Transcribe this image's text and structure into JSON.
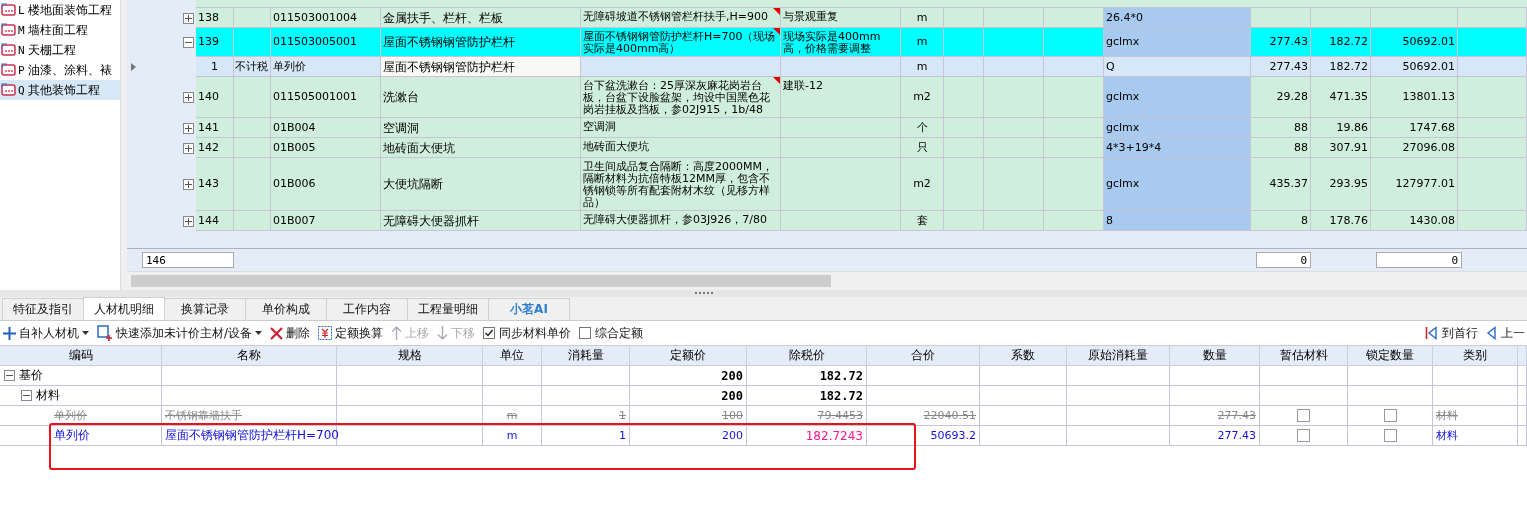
{
  "tree": {
    "items": [
      {
        "letter": "L",
        "label": "楼地面装饰工程",
        "selected": false
      },
      {
        "letter": "M",
        "label": "墙柱面工程",
        "selected": false
      },
      {
        "letter": "N",
        "label": "天棚工程",
        "selected": false
      },
      {
        "letter": "P",
        "label": "油漆、涂料、裱",
        "selected": false
      },
      {
        "letter": "Q",
        "label": "其他装饰工程",
        "selected": true
      }
    ]
  },
  "grid": {
    "rows": [
      {
        "kind": "item",
        "expanded": false,
        "selected": false,
        "flagged": true,
        "number": "138",
        "tax": "",
        "code": "011503001004",
        "name": "金属扶手、栏杆、栏板",
        "feature": "无障碍坡道不锈钢管栏杆扶手,H=900",
        "remark": "与景观重复",
        "unit": "m",
        "expression": "26.4*0",
        "quantity": "",
        "price": "",
        "total": ""
      },
      {
        "kind": "item",
        "expanded": true,
        "selected": true,
        "flagged": true,
        "number": "139",
        "tax": "",
        "code": "011503005001",
        "name": "屋面不锈钢钢管防护栏杆",
        "feature": "屋面不锈钢钢管防护栏杆H=700（现场实际是400mm高）",
        "remark": "现场实际是400mm高，价格需要调整",
        "unit": "m",
        "expression": "gclmx",
        "quantity": "277.43",
        "price": "182.72",
        "total": "50692.01"
      },
      {
        "kind": "sub",
        "expanded": false,
        "selected": false,
        "flagged": false,
        "number": "1",
        "tax": "不计税",
        "code": "单列价",
        "name": "屋面不锈钢钢管防护栏杆",
        "feature": "",
        "remark": "",
        "unit": "m",
        "expression": "Q",
        "quantity": "277.43",
        "price": "182.72",
        "total": "50692.01"
      },
      {
        "kind": "item",
        "expanded": false,
        "selected": false,
        "flagged": true,
        "number": "140",
        "tax": "",
        "code": "011505001001",
        "name": "洗漱台",
        "feature": "台下盆洗漱台：25厚深灰麻花岗岩台板，台盆下设脸盆架，均设中国黑色花岗岩挂板及挡板，参02J915，1b/48",
        "remark": "建联-12",
        "unit": "m2",
        "expression": "gclmx",
        "quantity": "29.28",
        "price": "471.35",
        "total": "13801.13"
      },
      {
        "kind": "item",
        "expanded": false,
        "selected": false,
        "flagged": false,
        "number": "141",
        "tax": "",
        "code": "01B004",
        "name": "空调洞",
        "feature": "空调洞",
        "remark": "",
        "unit": "个",
        "expression": "gclmx",
        "quantity": "88",
        "price": "19.86",
        "total": "1747.68"
      },
      {
        "kind": "item",
        "expanded": false,
        "selected": false,
        "flagged": false,
        "number": "142",
        "tax": "",
        "code": "01B005",
        "name": "地砖面大便坑",
        "feature": "地砖面大便坑",
        "remark": "",
        "unit": "只",
        "expression": "4*3+19*4",
        "quantity": "88",
        "price": "307.91",
        "total": "27096.08"
      },
      {
        "kind": "item",
        "expanded": false,
        "selected": false,
        "flagged": false,
        "number": "143",
        "tax": "",
        "code": "01B006",
        "name": "大便坑隔断",
        "feature": "卫生间成品复合隔断：高度2000MM，隔断材料为抗倍特板12MM厚，包含不锈钢锁等所有配套附材木纹（见移方样品）",
        "remark": "",
        "unit": "m2",
        "expression": "gclmx",
        "quantity": "435.37",
        "price": "293.95",
        "total": "127977.01"
      },
      {
        "kind": "item",
        "expanded": false,
        "selected": false,
        "flagged": false,
        "number": "144",
        "tax": "",
        "code": "01B007",
        "name": "无障碍大便器抓杆",
        "feature": "无障碍大便器抓杆，参03J926，7/80",
        "remark": "",
        "unit": "套",
        "expression": "8",
        "quantity": "8",
        "price": "178.76",
        "total": "1430.08"
      }
    ],
    "footer": {
      "count": "146",
      "quantity_sum": "0",
      "total_sum": "0"
    }
  },
  "tabs": [
    {
      "label": "特征及指引",
      "selected": false,
      "kind": "plain"
    },
    {
      "label": "人材机明细",
      "selected": true,
      "kind": "plain"
    },
    {
      "label": "换算记录",
      "selected": false,
      "kind": "plain"
    },
    {
      "label": "单价构成",
      "selected": false,
      "kind": "plain"
    },
    {
      "label": "工作内容",
      "selected": false,
      "kind": "plain"
    },
    {
      "label": "工程量明细",
      "selected": false,
      "kind": "plain"
    },
    {
      "label": "小茗AI",
      "selected": false,
      "kind": "ai"
    }
  ],
  "toolbar": {
    "items": [
      {
        "kind": "plus",
        "label": "自补人材机",
        "dropdown": true,
        "disabled": false
      },
      {
        "kind": "add",
        "label": "快速添加未计价主材/设备",
        "dropdown": true,
        "disabled": false
      },
      {
        "kind": "delete",
        "label": "删除",
        "dropdown": false,
        "disabled": false
      },
      {
        "kind": "convert",
        "label": "定额换算",
        "dropdown": false,
        "disabled": false
      },
      {
        "kind": "up",
        "label": "上移",
        "dropdown": false,
        "disabled": true
      },
      {
        "kind": "down",
        "label": "下移",
        "dropdown": false,
        "disabled": true
      },
      {
        "kind": "check",
        "label": "同步材料单价",
        "checked": true
      },
      {
        "kind": "check",
        "label": "综合定额",
        "checked": false
      }
    ],
    "nav": [
      {
        "kind": "first",
        "label": "到首行"
      },
      {
        "kind": "prev",
        "label": "上一"
      }
    ]
  },
  "detail": {
    "columns": [
      "编码",
      "名称",
      "规格",
      "单位",
      "消耗量",
      "定额价",
      "除税价",
      "合价",
      "系数",
      "原始消耗量",
      "数量",
      "暂估材料",
      "锁定数量",
      "类别"
    ],
    "rows": [
      {
        "code": "基价",
        "expanded": true,
        "base_price": "200",
        "net_price": "182.72",
        "children": [
          {
            "code": "材料",
            "expanded": true,
            "base_price": "200",
            "net_price": "182.72",
            "children": [
              {
                "code": "单列价",
                "name": "不锈钢靠墙扶手",
                "unit": "m",
                "consumption": "1",
                "base_price": "100",
                "net_price": "79.4453",
                "total": "22040.51",
                "quantity": "277.43",
                "estimated": false,
                "locked": false,
                "category": "材料",
                "struck": true,
                "price_changed": false
              },
              {
                "code": "单列价",
                "name": "屋面不锈钢钢管防护栏杆H=700",
                "unit": "m",
                "consumption": "1",
                "base_price": "200",
                "net_price": "182.7243",
                "total": "50693.2",
                "quantity": "277.43",
                "estimated": false,
                "locked": false,
                "category": "材料",
                "struck": false,
                "price_changed": true
              }
            ]
          }
        ]
      }
    ]
  }
}
